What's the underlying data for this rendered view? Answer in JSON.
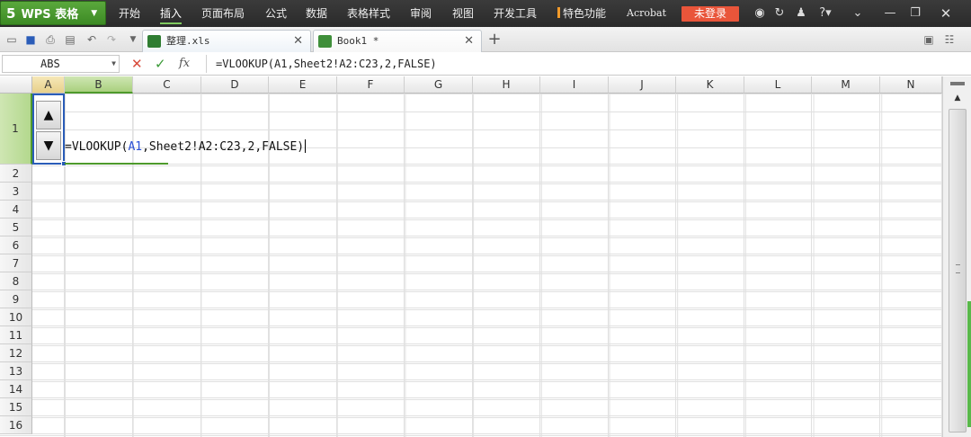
{
  "app": {
    "logo": "5",
    "title": "WPS 表格",
    "arrow": "▼"
  },
  "menu": {
    "items": [
      {
        "label": "开始",
        "active": false
      },
      {
        "label": "插入",
        "active": true
      },
      {
        "label": "页面布局",
        "active": false
      },
      {
        "label": "公式",
        "active": false
      },
      {
        "label": "数据",
        "active": false
      },
      {
        "label": "表格样式",
        "active": false
      },
      {
        "label": "审阅",
        "active": false
      },
      {
        "label": "视图",
        "active": false
      },
      {
        "label": "开发工具",
        "active": false
      }
    ],
    "special": "特色功能",
    "acrobat": "Acrobat",
    "login": "未登录"
  },
  "tabs": [
    {
      "name": "整理.xls",
      "close": "✕",
      "icon": "excel-file-icon",
      "color": "#2f7d32"
    },
    {
      "name": "Book1 *",
      "close": "✕",
      "icon": "workbook-icon",
      "color": "#3f8f3a"
    }
  ],
  "add_tab": "+",
  "formula_bar": {
    "name_box": "ABS",
    "cancel": "✕",
    "enter": "✓",
    "fx": "fx",
    "formula": "=VLOOKUP(A1,Sheet2!A2:C23,2,FALSE)"
  },
  "grid": {
    "columns": [
      "A",
      "B",
      "C",
      "D",
      "E",
      "F",
      "G",
      "H",
      "I",
      "J",
      "K",
      "L",
      "M",
      "N"
    ],
    "rows": [
      "1",
      "2",
      "3",
      "4",
      "5",
      "6",
      "7",
      "8",
      "9",
      "10",
      "11",
      "12",
      "13",
      "14",
      "15",
      "16"
    ],
    "selected_col": "A",
    "current_col": "B",
    "current_row": "1"
  },
  "cell_edit": {
    "prefix": "=VLOOKUP(",
    "ref": "A1",
    "suffix": ",Sheet2!A2:C23,2,FALSE)"
  },
  "spinner": {
    "up": "▲",
    "down": "▼"
  },
  "colors": {
    "accent": "#4e9a2c",
    "selection": "#2a5cb8",
    "login": "#e9553a"
  }
}
